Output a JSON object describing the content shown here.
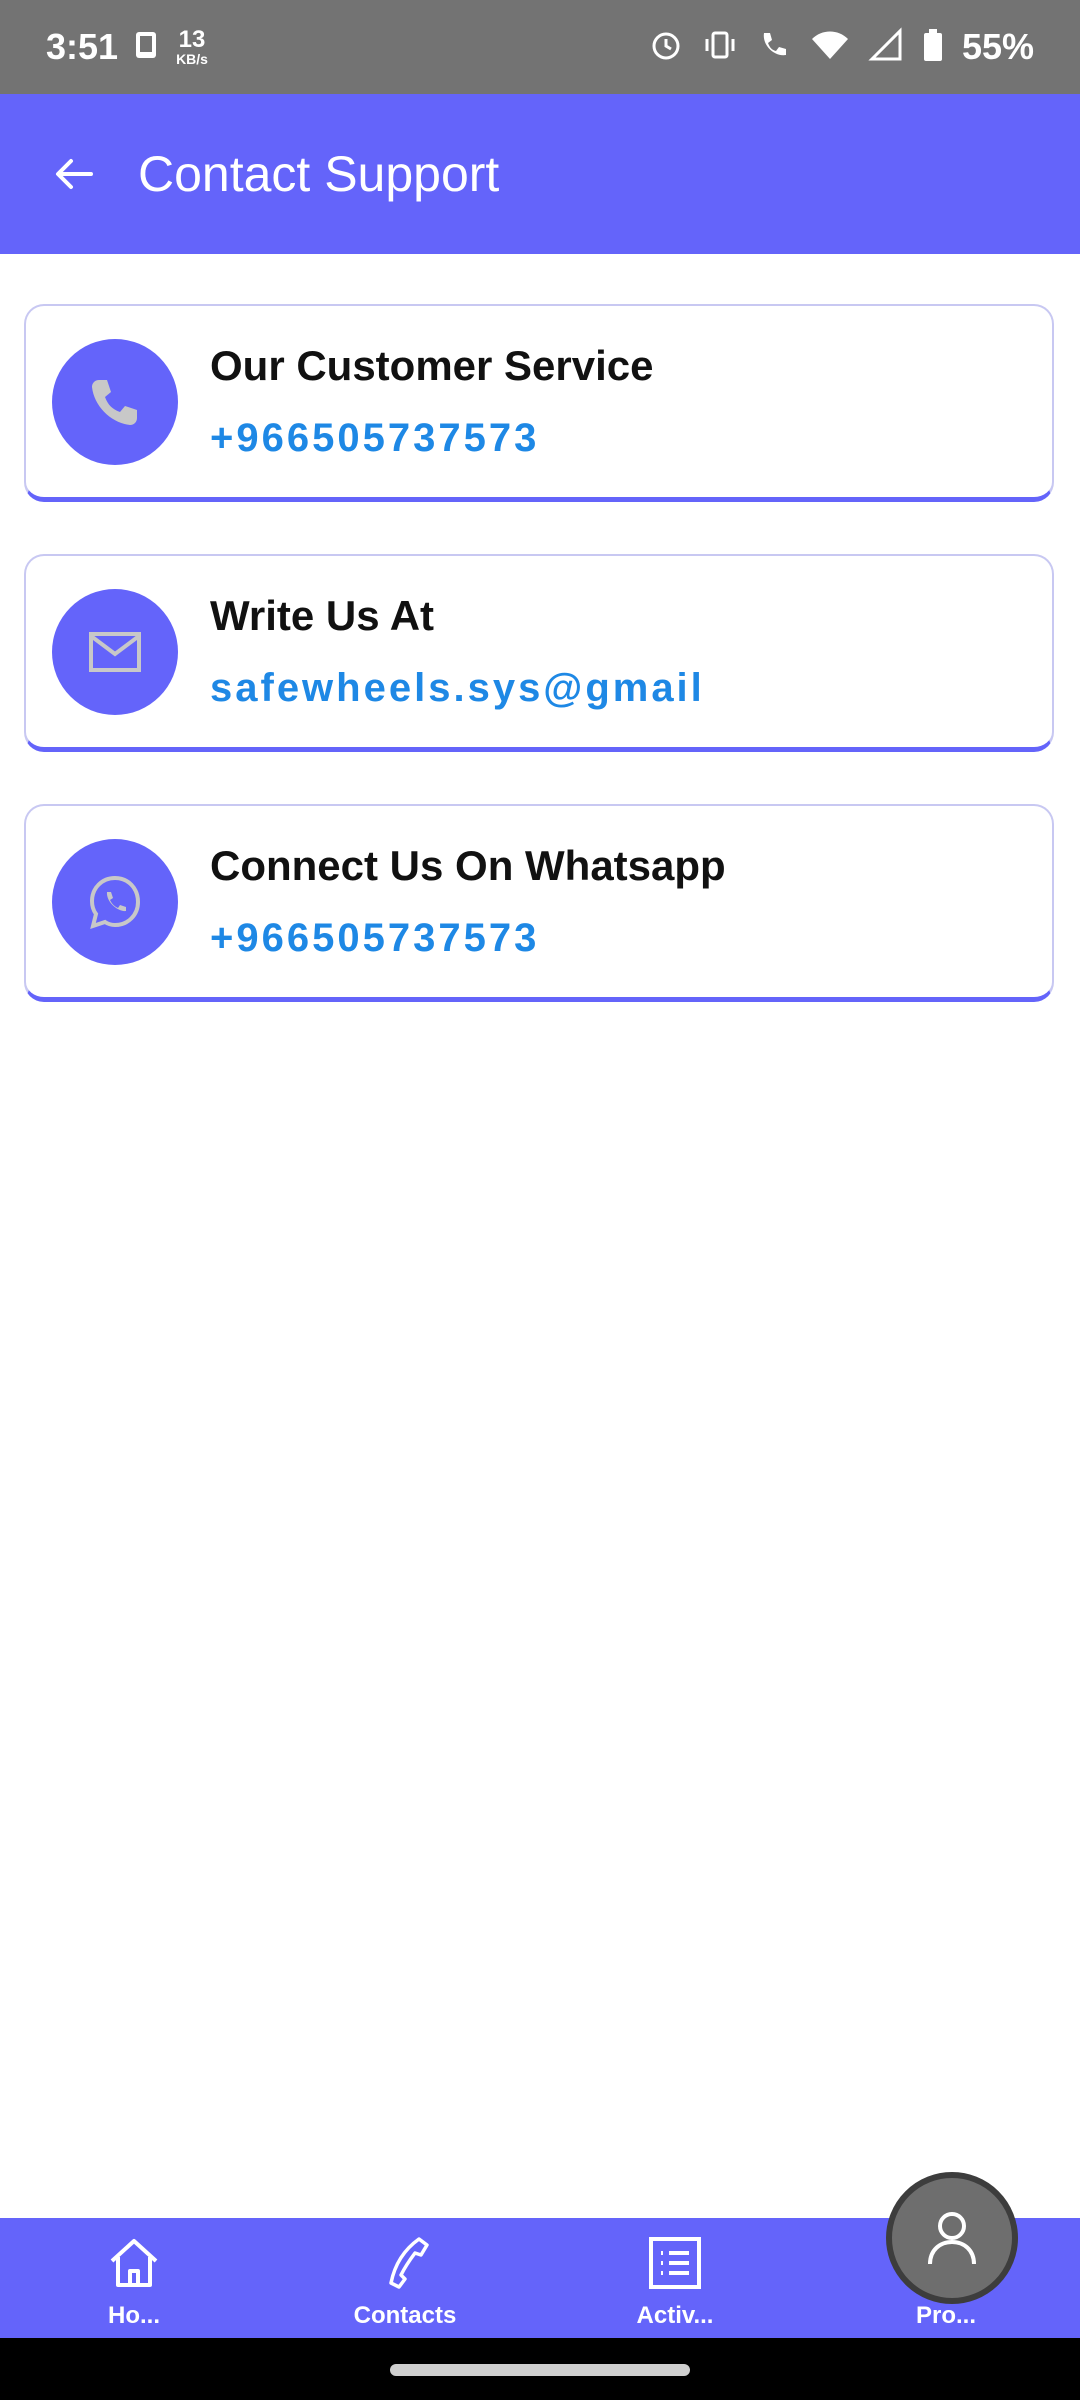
{
  "status_bar": {
    "time": "3:51",
    "speed_value": "13",
    "speed_unit": "KB/s",
    "battery": "55%"
  },
  "header": {
    "title": "Contact Support"
  },
  "cards": [
    {
      "title": "Our Customer Service",
      "value": "+966505737573",
      "icon": "phone-icon"
    },
    {
      "title": "Write Us At",
      "value": "safewheels.sys@gmail",
      "icon": "mail-icon"
    },
    {
      "title": "Connect Us On Whatsapp",
      "value": "+966505737573",
      "icon": "whatsapp-icon"
    }
  ],
  "bottom_nav": {
    "items": [
      {
        "label": "Ho...",
        "icon": "home-icon"
      },
      {
        "label": "Contacts",
        "icon": "phone-icon"
      },
      {
        "label": "Activ...",
        "icon": "list-icon"
      },
      {
        "label": "Pro...",
        "icon": "person-icon"
      }
    ]
  },
  "colors": {
    "primary": "#6464fa",
    "link": "#1e88e5",
    "status_bar": "#737373"
  }
}
